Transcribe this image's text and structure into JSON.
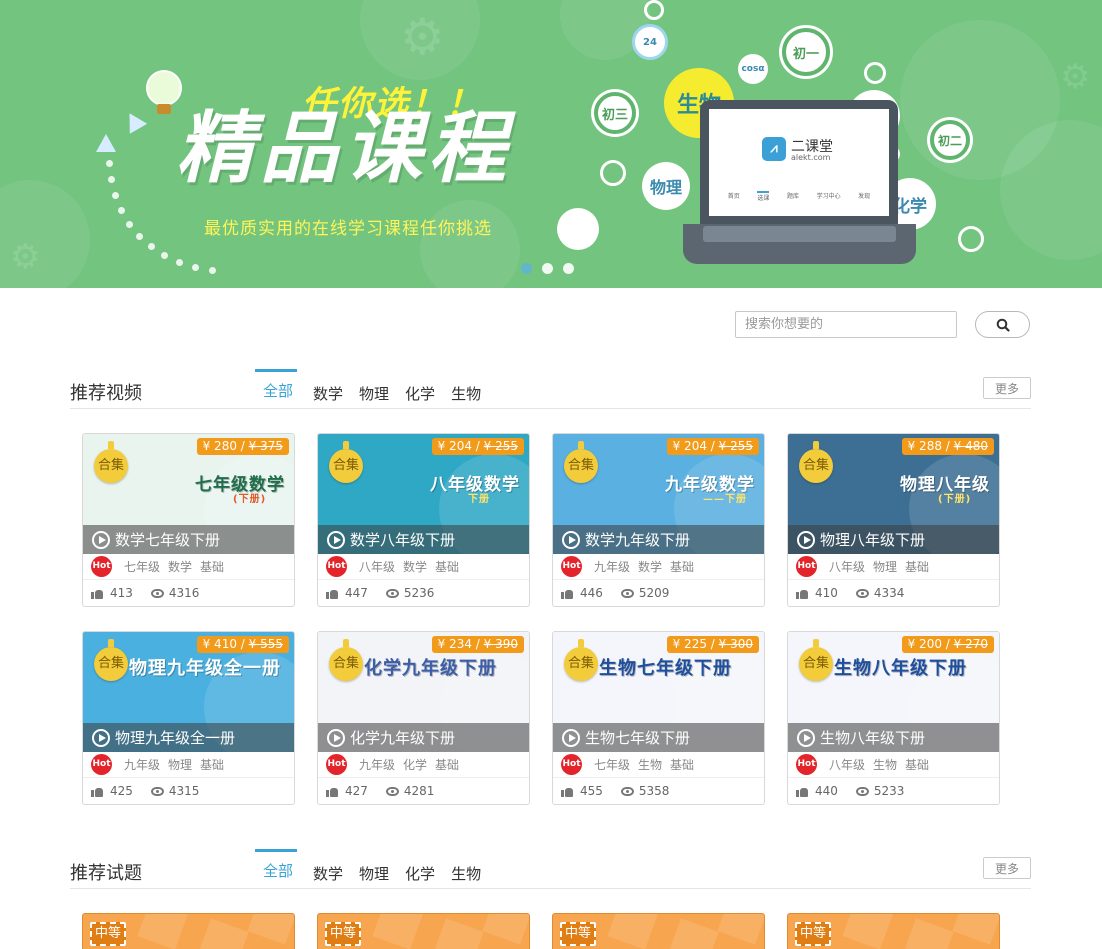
{
  "banner": {
    "title": "精品课程",
    "badge": "任你选！！",
    "subtitle": "最优质实用的在线学习课程任你挑选",
    "bubbles": {
      "grade3": "初三",
      "grade1": "初一",
      "grade2": "初二",
      "biology": "生物",
      "physics": "物理",
      "chemistry": "化学",
      "cos": "cosα",
      "clock": "24"
    },
    "laptop": {
      "name": "二课堂",
      "url": "alekt.com",
      "nav": [
        "首页",
        "选课",
        "题库",
        "学习中心",
        "发现"
      ]
    },
    "slides": 3,
    "active_slide": 1
  },
  "search": {
    "placeholder": "搜索你想要的"
  },
  "video_section": {
    "title": "推荐视频",
    "tabs": [
      "全部",
      "数学",
      "物理",
      "化学",
      "生物"
    ],
    "active_tab": 0,
    "more": "更多",
    "collection_tag": "合集",
    "hot_tag": "Hot",
    "courses": [
      {
        "name": "数学七年级下册",
        "thumb_title": "七年级数学",
        "thumb_sub": "(下册)",
        "price": "¥ 280 / ",
        "old_price": "¥ 375",
        "grade": "七年级",
        "subject": "数学",
        "level": "基础",
        "likes": "413",
        "views": "4316",
        "bg": "#e9f4ef",
        "fg": "#1f6f4a"
      },
      {
        "name": "数学八年级下册",
        "thumb_title": "八年级数学",
        "thumb_sub": "下册",
        "price": "¥ 204 / ",
        "old_price": "¥ 255",
        "grade": "八年级",
        "subject": "数学",
        "level": "基础",
        "likes": "447",
        "views": "5236",
        "bg": "#2fa8c6",
        "fg": "#ffffff"
      },
      {
        "name": "数学九年级下册",
        "thumb_title": "九年级数学",
        "thumb_sub": "——下册",
        "price": "¥ 204 / ",
        "old_price": "¥ 255",
        "grade": "九年级",
        "subject": "数学",
        "level": "基础",
        "likes": "446",
        "views": "5209",
        "bg": "#5ab0e0",
        "fg": "#ffffff"
      },
      {
        "name": "物理八年级下册",
        "thumb_title": "物理八年级",
        "thumb_sub": "(下册)",
        "price": "¥ 288 / ",
        "old_price": "¥ 480",
        "grade": "八年级",
        "subject": "物理",
        "level": "基础",
        "likes": "410",
        "views": "4334",
        "bg": "#3d6f95",
        "fg": "#ffffff"
      },
      {
        "name": "物理九年级全一册",
        "thumb_title": "物理九年级全一册",
        "thumb_sub": "",
        "price": "¥ 410 / ",
        "old_price": "¥ 555",
        "grade": "九年级",
        "subject": "物理",
        "level": "基础",
        "likes": "425",
        "views": "4315",
        "bg": "#4ab0e0",
        "fg": "#ffffff"
      },
      {
        "name": "化学九年级下册",
        "thumb_title": "化学九年级下册",
        "thumb_sub": "",
        "price": "¥ 234 / ",
        "old_price": "¥ 390",
        "grade": "九年级",
        "subject": "化学",
        "level": "基础",
        "likes": "427",
        "views": "4281",
        "bg": "#f3f4f8",
        "fg": "#3c5ea8"
      },
      {
        "name": "生物七年级下册",
        "thumb_title": "生物七年级下册",
        "thumb_sub": "",
        "price": "¥ 225 / ",
        "old_price": "¥ 300",
        "grade": "七年级",
        "subject": "生物",
        "level": "基础",
        "likes": "455",
        "views": "5358",
        "bg": "#f4f6fb",
        "fg": "#1e4f9e"
      },
      {
        "name": "生物八年级下册",
        "thumb_title": "生物八年级下册",
        "thumb_sub": "",
        "price": "¥ 200 / ",
        "old_price": "¥ 270",
        "grade": "八年级",
        "subject": "生物",
        "level": "基础",
        "likes": "440",
        "views": "5233",
        "bg": "#f4f6fb",
        "fg": "#1e4f9e"
      }
    ]
  },
  "exercise_section": {
    "title": "推荐试题",
    "tabs": [
      "全部",
      "数学",
      "物理",
      "化学",
      "生物"
    ],
    "active_tab": 0,
    "more": "更多",
    "cards": [
      {
        "level": "中等"
      },
      {
        "level": "中等"
      },
      {
        "level": "中等"
      },
      {
        "level": "中等"
      }
    ]
  }
}
